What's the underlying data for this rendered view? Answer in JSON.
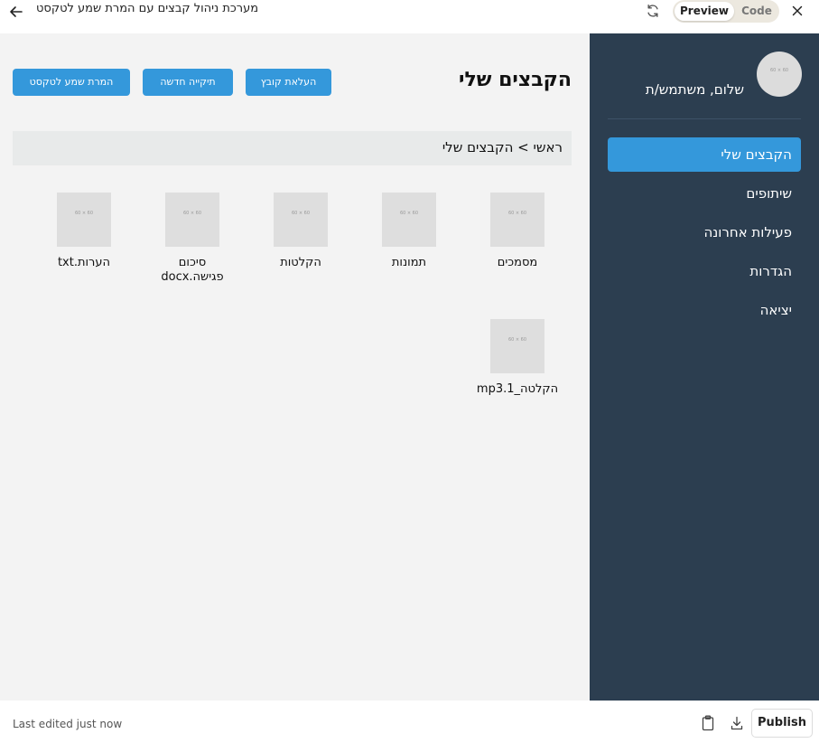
{
  "window": {
    "title": "מערכת ניהול קבצים עם המרת שמע לטקסט",
    "toggle_preview": "Preview",
    "toggle_code": "Code"
  },
  "sidebar": {
    "avatar_text": "60 × 60",
    "greeting": "שלום, משתמש/ת",
    "items": [
      {
        "label": "הקבצים שלי",
        "active": true
      },
      {
        "label": "שיתופים",
        "active": false
      },
      {
        "label": "פעילות אחרונה",
        "active": false
      },
      {
        "label": "הגדרות",
        "active": false
      },
      {
        "label": "יציאה",
        "active": false
      }
    ]
  },
  "main": {
    "heading": "הקבצים שלי",
    "buttons": {
      "upload": "העלאת קובץ",
      "new_folder": "תיקייה חדשה",
      "convert": "המרת שמע לטקסט"
    },
    "breadcrumb": "ראשי > הקבצים שלי",
    "thumb_placeholder": "60 × 60",
    "files": [
      {
        "name": "מסמכים",
        "type": "folder"
      },
      {
        "name": "תמונות",
        "type": "folder"
      },
      {
        "name": "הקלטות",
        "type": "folder"
      },
      {
        "name": "סיכום פגישה.docx",
        "type": "file"
      },
      {
        "name": "הערות.txt",
        "type": "file"
      },
      {
        "name": "הקלטה_1.mp3",
        "type": "file"
      }
    ]
  },
  "footer": {
    "last_edited": "Last edited just now",
    "publish": "Publish"
  },
  "icons": {
    "back": "arrow-left-icon",
    "refresh": "refresh-icon",
    "close": "close-icon",
    "clipboard": "clipboard-icon",
    "download": "download-icon"
  },
  "colors": {
    "sidebar_bg": "#2c3e50",
    "accent": "#3498db",
    "content_bg": "#f3f3f3",
    "breadcrumb_bg": "#e8eaea"
  }
}
